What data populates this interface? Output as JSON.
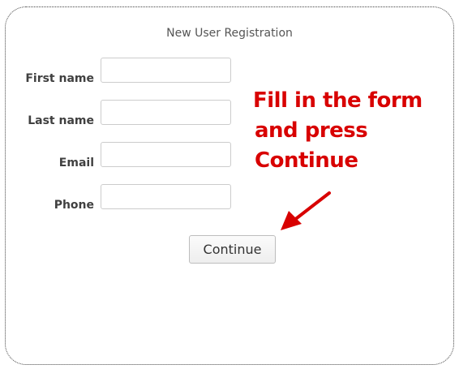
{
  "form": {
    "title": "New User Registration",
    "fields": [
      {
        "label": "First name",
        "value": "",
        "placeholder": ""
      },
      {
        "label": "Last name",
        "value": "",
        "placeholder": ""
      },
      {
        "label": "Email",
        "value": "",
        "placeholder": ""
      },
      {
        "label": "Phone",
        "value": "",
        "placeholder": ""
      }
    ],
    "submit_label": "Continue"
  },
  "annotation": {
    "lines": [
      "Fill in the form",
      "and press",
      "Continue"
    ],
    "color": "#d80000",
    "icon": "red-arrow-icon"
  }
}
